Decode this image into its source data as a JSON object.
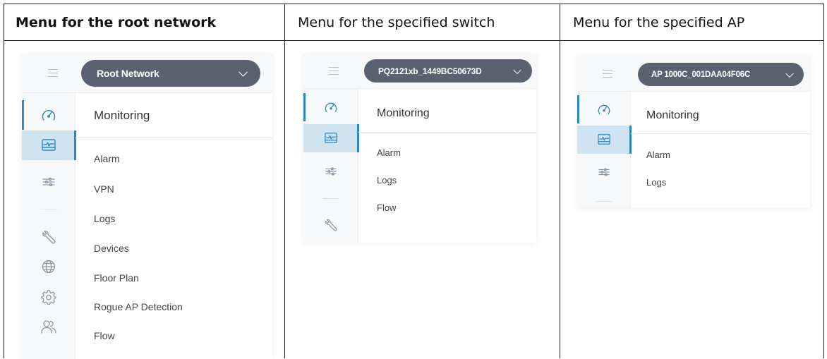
{
  "table": {
    "headers": [
      "Menu for the root network",
      "Menu for the specified switch",
      "Menu for the specified AP"
    ]
  },
  "panels": [
    {
      "network_select": "Root Network",
      "section_title": "Monitoring",
      "menu_items": [
        "Alarm",
        "VPN",
        "Logs",
        "Devices",
        "Floor Plan",
        "Rogue AP Detection",
        "Flow"
      ],
      "rail_icons": [
        "dashboard-icon",
        "monitoring-icon",
        "settings-sliders-icon",
        "maintenance-icon",
        "globe-icon",
        "gear-icon",
        "users-icon"
      ]
    },
    {
      "network_select": "PQ2121xb_1449BC50673D",
      "section_title": "Monitoring",
      "menu_items": [
        "Alarm",
        "Logs",
        "Flow"
      ],
      "rail_icons": [
        "dashboard-icon",
        "monitoring-icon",
        "settings-sliders-icon",
        "maintenance-icon"
      ]
    },
    {
      "network_select": "AP 1000C_001DAA04F06C",
      "section_title": "Monitoring",
      "menu_items": [
        "Alarm",
        "Logs"
      ],
      "rail_icons": [
        "dashboard-icon",
        "monitoring-icon",
        "settings-sliders-icon"
      ]
    }
  ],
  "colors": {
    "accent": "#2e86c1",
    "active_bg": "#cfe3f1",
    "select_bg": "#5a6272",
    "rail_bg": "#f7f8fa"
  }
}
